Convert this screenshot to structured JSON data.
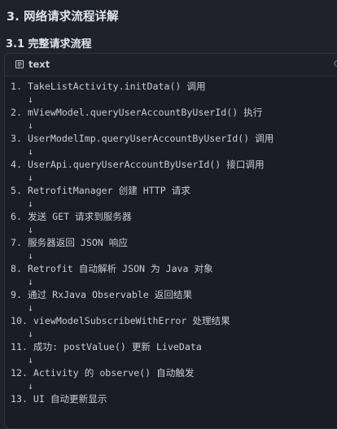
{
  "section_title": "3. 网络请求流程详解",
  "subsection_title": "3.1 完整请求流程",
  "code_block": {
    "language": "text",
    "language_icon": "file-lines-icon",
    "copy_label": "C",
    "lines": [
      "1. TakeListActivity.initData() 调用",
      "   ↓",
      "2. mViewModel.queryUserAccountByUserId() 执行",
      "   ↓",
      "3. UserModelImp.queryUserAccountByUserId() 调用",
      "   ↓",
      "4. UserApi.queryUserAccountByUserId() 接口调用",
      "   ↓",
      "5. RetrofitManager 创建 HTTP 请求",
      "   ↓",
      "6. 发送 GET 请求到服务器",
      "   ↓",
      "7. 服务器返回 JSON 响应",
      "   ↓",
      "8. Retrofit 自动解析 JSON 为 Java 对象",
      "   ↓",
      "9. 通过 RxJava Observable 返回结果",
      "   ↓",
      "10. viewModelSubscribeWithError 处理结果",
      "   ↓",
      "11. 成功: postValue() 更新 LiveData",
      "   ↓",
      "12. Activity 的 observe() 自动触发",
      "   ↓",
      "13. UI 自动更新显示"
    ]
  }
}
